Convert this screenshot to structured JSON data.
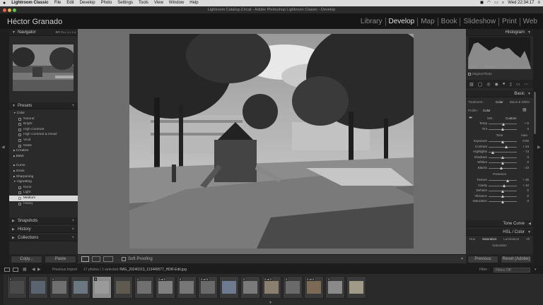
{
  "menubar": {
    "app": "Lightroom Classic",
    "items": [
      "File",
      "Edit",
      "Develop",
      "Photo",
      "Settings",
      "Tools",
      "View",
      "Window",
      "Help"
    ],
    "clock": "Wed 22:34:17"
  },
  "window_title": "Lightroom Catalog-2.lrcat - Adobe Photoshop Lightroom Classic - Develop",
  "identity_plate": "Héctor Granado",
  "modules": [
    "Library",
    "Develop",
    "Map",
    "Book",
    "Slideshow",
    "Print",
    "Web"
  ],
  "active_module": "Develop",
  "left_panel": {
    "navigator": {
      "title": "Navigator",
      "zoom": [
        "FIT",
        "FILL",
        "1:1",
        "1:4"
      ]
    },
    "presets": {
      "title": "Presets",
      "items": [
        {
          "label": "Color",
          "type": "folder"
        },
        {
          "label": "Natural",
          "type": "item"
        },
        {
          "label": "Bright",
          "type": "item"
        },
        {
          "label": "High Contrast",
          "type": "item"
        },
        {
          "label": "High Contrast & Detail",
          "type": "item"
        },
        {
          "label": "Vivid",
          "type": "item"
        },
        {
          "label": "Matte",
          "type": "item"
        },
        {
          "label": "Creative",
          "type": "folder"
        },
        {
          "label": "B&W",
          "type": "folder"
        },
        {
          "label": "",
          "type": "gap"
        },
        {
          "label": "Curve",
          "type": "folder"
        },
        {
          "label": "Grain",
          "type": "folder"
        },
        {
          "label": "Sharpening",
          "type": "folder"
        },
        {
          "label": "Vignetting",
          "type": "folder"
        },
        {
          "label": "None",
          "type": "item"
        },
        {
          "label": "Light",
          "type": "item"
        },
        {
          "label": "Medium",
          "type": "item",
          "selected": true
        },
        {
          "label": "Heavy",
          "type": "item"
        }
      ]
    },
    "snapshots": "Snapshots",
    "history": "History",
    "collections": "Collections",
    "copy_btn": "Copy...",
    "paste_btn": "Paste"
  },
  "right_panel": {
    "histogram": {
      "title": "Histogram",
      "readouts": [
        "ISO 55",
        "4.25 mm",
        "f / 1.8",
        "1/244 sec"
      ],
      "original_photo": "Original Photo"
    },
    "basic": {
      "title": "Basic",
      "treatment_label": "Treatment :",
      "treatment_color": "Color",
      "treatment_bw": "Black & White",
      "profile_label": "Profile :",
      "profile_value": "Color",
      "wb_label": "WB :",
      "wb_value": "Custom",
      "tone_label": "Tone",
      "auto_label": "Auto",
      "presence_label": "Presence",
      "sliders": [
        {
          "label": "Temp",
          "value": "+ 5",
          "pos": 0.52,
          "group": "wb"
        },
        {
          "label": "Tint",
          "value": "0",
          "pos": 0.5,
          "group": "wb"
        },
        {
          "label": "Exposure",
          "value": "0.00",
          "pos": 0.5,
          "group": "tone"
        },
        {
          "label": "Contrast",
          "value": "+ 24",
          "pos": 0.62,
          "group": "tone"
        },
        {
          "label": "Highlights",
          "value": "- 73",
          "pos": 0.14,
          "group": "tone"
        },
        {
          "label": "Shadows",
          "value": "0",
          "pos": 0.5,
          "group": "tone"
        },
        {
          "label": "Whites",
          "value": "0",
          "pos": 0.5,
          "group": "tone"
        },
        {
          "label": "Blacks",
          "value": "- 10",
          "pos": 0.45,
          "group": "tone"
        },
        {
          "label": "Texture",
          "value": "+ 35",
          "pos": 0.68,
          "group": "presence"
        },
        {
          "label": "Clarity",
          "value": "+ 10",
          "pos": 0.55,
          "group": "presence"
        },
        {
          "label": "Dehaze",
          "value": "0",
          "pos": 0.5,
          "group": "presence"
        },
        {
          "label": "Vibrance",
          "value": "0",
          "pos": 0.5,
          "group": "presence"
        },
        {
          "label": "Saturation",
          "value": "0",
          "pos": 0.5,
          "group": "presence"
        }
      ]
    },
    "tone_curve": "Tone Curve",
    "hsl": "HSL / Color",
    "hsl_tabs": [
      "Hue",
      "Saturation",
      "Luminance",
      "All"
    ],
    "hsl_sub": "Saturation",
    "previous_btn": "Previous",
    "reset_btn": "Reset (Adobe)"
  },
  "toolbar": {
    "soft_proofing": "Soft Proofing"
  },
  "filmstrip_bar": {
    "source": "Previous Import",
    "count": "17 photos / 1 selected /",
    "filename": "IMG_20240313_113449577_HDR-Edit.jpg",
    "filter_label": "Filter :",
    "filter_value": "Filters Off"
  },
  "filmstrip": [
    {
      "tag": "2",
      "tone": "#4a4a4a"
    },
    {
      "tag": "",
      "tone": "#5a6470"
    },
    {
      "tag": "2",
      "tone": "#707070"
    },
    {
      "tag": "",
      "tone": "#6c7880"
    },
    {
      "tag": "2",
      "tone": "#9a9a9a",
      "selected": true
    },
    {
      "tag": "",
      "tone": "#5e5a50"
    },
    {
      "tag": "2",
      "tone": "#707070"
    },
    {
      "tag": "2 of 2",
      "tone": "#808080"
    },
    {
      "tag": "2",
      "tone": "#777777"
    },
    {
      "tag": "2 of 3",
      "tone": "#6a6a6a"
    },
    {
      "tag": "",
      "tone": "#6e7a90"
    },
    {
      "tag": "2",
      "tone": "#7a7a7a"
    },
    {
      "tag": "2 of 2",
      "tone": "#8a8070"
    },
    {
      "tag": "2",
      "tone": "#6a6a6a"
    },
    {
      "tag": "2 of 2",
      "tone": "#7c6a58"
    },
    {
      "tag": "2",
      "tone": "#8a8a8a"
    },
    {
      "tag": "",
      "tone": "#a09a88"
    }
  ]
}
